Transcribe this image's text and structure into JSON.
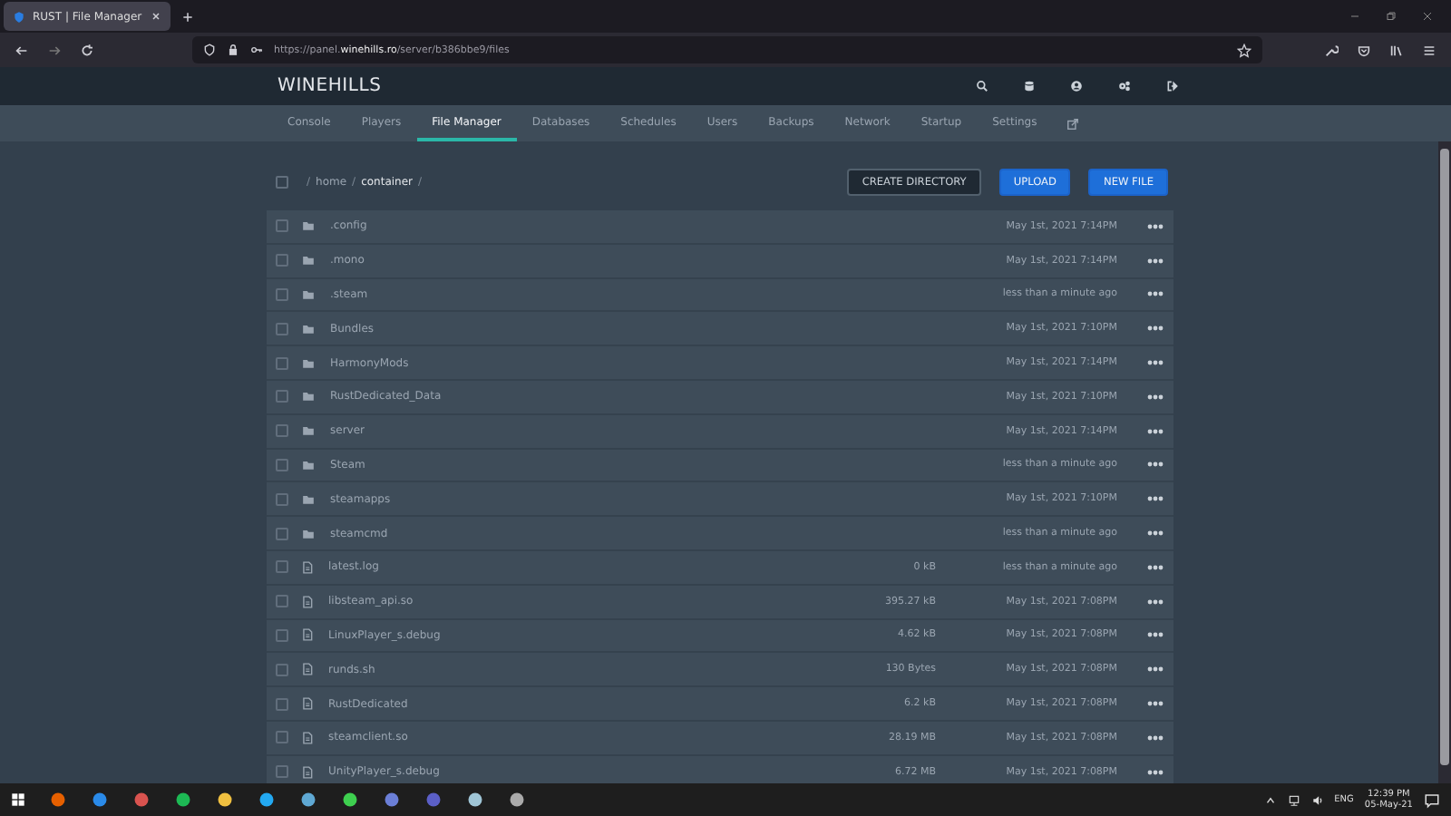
{
  "browser": {
    "tab_title": "RUST | File Manager",
    "url": "https://panel.**winehills.ro**/server/b386bbe9/files"
  },
  "header": {
    "brand": "WINEHILLS"
  },
  "nav": [
    {
      "label": "Console",
      "selected": false
    },
    {
      "label": "Players",
      "selected": false
    },
    {
      "label": "File Manager",
      "selected": true
    },
    {
      "label": "Databases",
      "selected": false
    },
    {
      "label": "Schedules",
      "selected": false
    },
    {
      "label": "Users",
      "selected": false
    },
    {
      "label": "Backups",
      "selected": false
    },
    {
      "label": "Network",
      "selected": false
    },
    {
      "label": "Startup",
      "selected": false
    },
    {
      "label": "Settings",
      "selected": false
    }
  ],
  "select_all": {
    "checked": false
  },
  "breadcrumb": [
    {
      "text": "/",
      "kind": "separator"
    },
    {
      "text": "home",
      "kind": "dir"
    },
    {
      "text": "/",
      "kind": "separator"
    },
    {
      "text": "container",
      "kind": "current"
    },
    {
      "text": "/",
      "kind": "separator"
    }
  ],
  "buttons": [
    {
      "label": "CREATE DIRECTORY",
      "kind": "outline"
    },
    {
      "label": "UPLOAD",
      "kind": "primary"
    },
    {
      "label": "NEW FILE",
      "kind": "primary"
    }
  ],
  "files": [
    {
      "name": ".config",
      "kind": "folder",
      "checked": false,
      "modified": "May 1st, 2021 7:14PM"
    },
    {
      "name": ".mono",
      "kind": "folder",
      "checked": false,
      "modified": "May 1st, 2021 7:14PM"
    },
    {
      "name": ".steam",
      "kind": "folder",
      "checked": false,
      "modified": "less than a minute ago"
    },
    {
      "name": "Bundles",
      "kind": "folder",
      "checked": false,
      "modified": "May 1st, 2021 7:10PM"
    },
    {
      "name": "HarmonyMods",
      "kind": "folder",
      "checked": false,
      "modified": "May 1st, 2021 7:14PM"
    },
    {
      "name": "RustDedicated_Data",
      "kind": "folder",
      "checked": false,
      "modified": "May 1st, 2021 7:10PM"
    },
    {
      "name": "server",
      "kind": "folder",
      "checked": false,
      "modified": "May 1st, 2021 7:14PM"
    },
    {
      "name": "Steam",
      "kind": "folder",
      "checked": false,
      "modified": "less than a minute ago"
    },
    {
      "name": "steamapps",
      "kind": "folder",
      "checked": false,
      "modified": "May 1st, 2021 7:10PM"
    },
    {
      "name": "steamcmd",
      "kind": "folder",
      "checked": false,
      "modified": "less than a minute ago"
    },
    {
      "name": "latest.log",
      "kind": "file",
      "checked": false,
      "size": "0 kB",
      "modified": "less than a minute ago"
    },
    {
      "name": "libsteam_api.so",
      "kind": "file",
      "checked": false,
      "size": "395.27 kB",
      "modified": "May 1st, 2021 7:08PM"
    },
    {
      "name": "LinuxPlayer_s.debug",
      "kind": "file",
      "checked": false,
      "size": "4.62 kB",
      "modified": "May 1st, 2021 7:08PM"
    },
    {
      "name": "runds.sh",
      "kind": "file",
      "checked": false,
      "size": "130 Bytes",
      "modified": "May 1st, 2021 7:08PM"
    },
    {
      "name": "RustDedicated",
      "kind": "file",
      "checked": false,
      "size": "6.2 kB",
      "modified": "May 1st, 2021 7:08PM"
    },
    {
      "name": "steamclient.so",
      "kind": "file",
      "checked": false,
      "size": "28.19 MB",
      "modified": "May 1st, 2021 7:08PM"
    },
    {
      "name": "UnityPlayer_s.debug",
      "kind": "file",
      "checked": false,
      "size": "6.72 MB",
      "modified": "May 1st, 2021 7:08PM"
    }
  ],
  "taskbar": {
    "language": "ENG",
    "time": "12:39 PM",
    "date": "05-May-21"
  }
}
